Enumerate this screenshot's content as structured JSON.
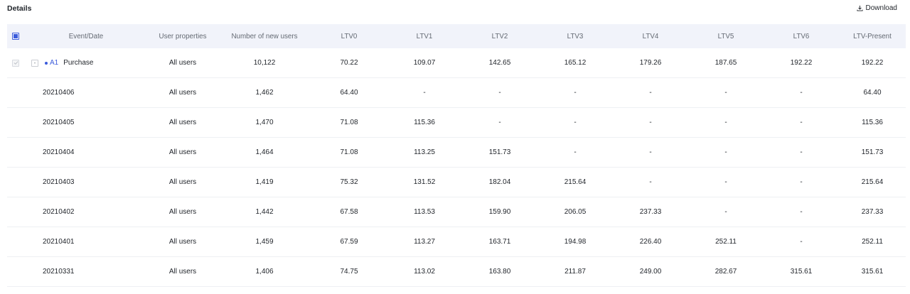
{
  "header": {
    "title": "Details",
    "download_label": "Download",
    "download_icon": "download-icon"
  },
  "columns": [
    "Event/Date",
    "User properties",
    "Number of new users",
    "LTV0",
    "LTV1",
    "LTV2",
    "LTV3",
    "LTV4",
    "LTV5",
    "LTV6",
    "LTV-Present"
  ],
  "summary": {
    "collapse_symbol": "-",
    "badge": "A1",
    "event": "Purchase",
    "user_properties": "All users",
    "new_users": "10,122",
    "ltv": [
      "70.22",
      "109.07",
      "142.65",
      "165.12",
      "179.26",
      "187.65",
      "192.22",
      "192.22"
    ]
  },
  "rows": [
    {
      "date": "20210406",
      "user_properties": "All users",
      "new_users": "1,462",
      "ltv": [
        "64.40",
        "-",
        "-",
        "-",
        "-",
        "-",
        "-",
        "64.40"
      ]
    },
    {
      "date": "20210405",
      "user_properties": "All users",
      "new_users": "1,470",
      "ltv": [
        "71.08",
        "115.36",
        "-",
        "-",
        "-",
        "-",
        "-",
        "115.36"
      ]
    },
    {
      "date": "20210404",
      "user_properties": "All users",
      "new_users": "1,464",
      "ltv": [
        "71.08",
        "113.25",
        "151.73",
        "-",
        "-",
        "-",
        "-",
        "151.73"
      ]
    },
    {
      "date": "20210403",
      "user_properties": "All users",
      "new_users": "1,419",
      "ltv": [
        "75.32",
        "131.52",
        "182.04",
        "215.64",
        "-",
        "-",
        "-",
        "215.64"
      ]
    },
    {
      "date": "20210402",
      "user_properties": "All users",
      "new_users": "1,442",
      "ltv": [
        "67.58",
        "113.53",
        "159.90",
        "206.05",
        "237.33",
        "-",
        "-",
        "237.33"
      ]
    },
    {
      "date": "20210401",
      "user_properties": "All users",
      "new_users": "1,459",
      "ltv": [
        "67.59",
        "113.27",
        "163.71",
        "194.98",
        "226.40",
        "252.11",
        "-",
        "252.11"
      ]
    },
    {
      "date": "20210331",
      "user_properties": "All users",
      "new_users": "1,406",
      "ltv": [
        "74.75",
        "113.02",
        "163.80",
        "211.87",
        "249.00",
        "282.67",
        "315.61",
        "315.61"
      ]
    }
  ],
  "colors": {
    "accent": "#3b5bdb",
    "header_bg": "#f1f3fa",
    "row_border": "#eef0f3"
  }
}
